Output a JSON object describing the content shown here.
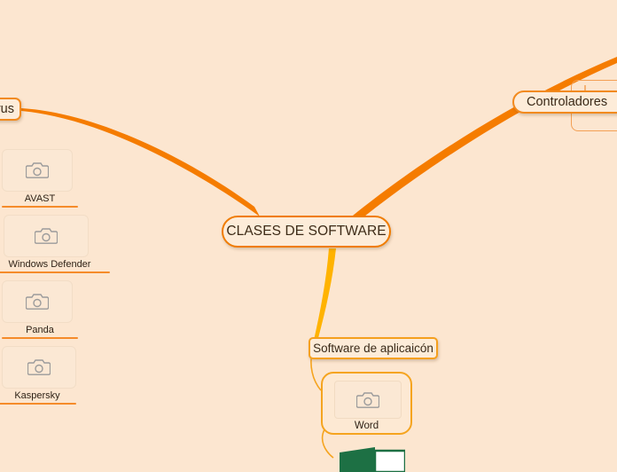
{
  "diagram": {
    "type": "mind-map",
    "background_color": "#fce6d0",
    "branch_color_primary": "#f57c00",
    "branch_color_secondary": "#ffb300",
    "node_border_color": "#f28a1e",
    "node_fill_color": "#fdecd9",
    "accent_underline_color": "#f58b2a",
    "central_node": {
      "label": "CLASES DE SOFTWARE"
    },
    "branches": [
      {
        "id": "antivirus",
        "label": "rus",
        "full_label_hint": "rus",
        "direction": "left",
        "clipped": true
      },
      {
        "id": "controladores",
        "label": "Controladores",
        "direction": "upper-right",
        "clipped": true
      },
      {
        "id": "software-aplicacion",
        "label": "Software de aplicaicón",
        "direction": "down",
        "clipped": false
      }
    ],
    "image_items": [
      {
        "id": "avast",
        "caption": "AVAST",
        "icon": "camera-placeholder-icon"
      },
      {
        "id": "defender",
        "caption": "Windows Defender",
        "icon": "camera-placeholder-icon"
      },
      {
        "id": "panda",
        "caption": "Panda",
        "icon": "camera-placeholder-icon"
      },
      {
        "id": "kaspersky",
        "caption": "Kaspersky",
        "icon": "camera-placeholder-icon"
      }
    ],
    "application_items": [
      {
        "id": "word",
        "caption": "Word",
        "icon": "camera-placeholder-icon"
      },
      {
        "id": "excel",
        "caption": "",
        "icon": "excel-logo-icon",
        "clipped": true,
        "color": "#1d7044"
      }
    ]
  }
}
